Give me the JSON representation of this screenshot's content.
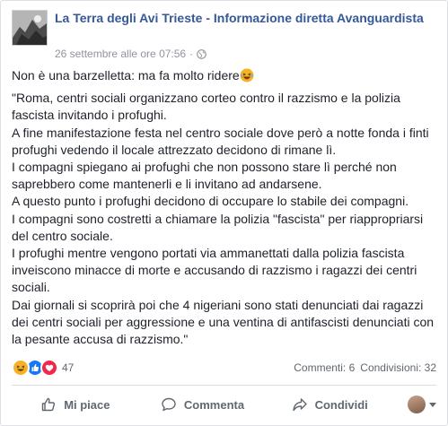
{
  "post": {
    "page_name": "La Terra degli Avi Trieste - Informazione diretta Avanguardista",
    "timestamp": "26 settembre alle ore 07:56",
    "separator": "·",
    "intro": "Non è una barzelletta: ma fa molto ridere",
    "paragraphs": [
      "\"Roma, centri sociali organizzano corteo contro il razzismo e la polizia fascista invitando i profughi.",
      "A fine manifestazione festa nel centro sociale dove però a notte fonda i finti profughi vedendo il locale attrezzato decidono di rimane lì.",
      "I compagni spiegano ai profughi che non possono stare lì perché non saprebbero come mantenerli e li invitano ad andarsene.",
      "A questo punto i profughi decidono di occupare lo stabile dei compagni.",
      "I compagni sono costretti a chiamare la polizia \"fascista\" per riappropriarsi del centro sociale.",
      "I profughi mentre vengono portati via ammanettati dalla polizia fascista inveiscono minacce di morte e accusando di razzismo i ragazzi dei centri sociali.",
      "Dai giornali si scoprirà poi che 4 nigeriani sono stati denunciati dai ragazzi dei centri sociali per aggressione e una ventina di antifascisti denunciati con la pesante accusa di razzismo.\""
    ]
  },
  "stats": {
    "reaction_count": "47",
    "comments": "Commenti: 6",
    "shares": "Condivisioni: 32",
    "reactions": [
      "haha-icon",
      "like-icon",
      "love-icon"
    ]
  },
  "actions": {
    "like": "Mi piace",
    "comment": "Commenta",
    "share": "Condividi"
  },
  "colors": {
    "link": "#365899",
    "muted": "#90949c",
    "action": "#606770",
    "like": "#1877f2",
    "love": "#f0284a",
    "haha": "#f7b125"
  }
}
